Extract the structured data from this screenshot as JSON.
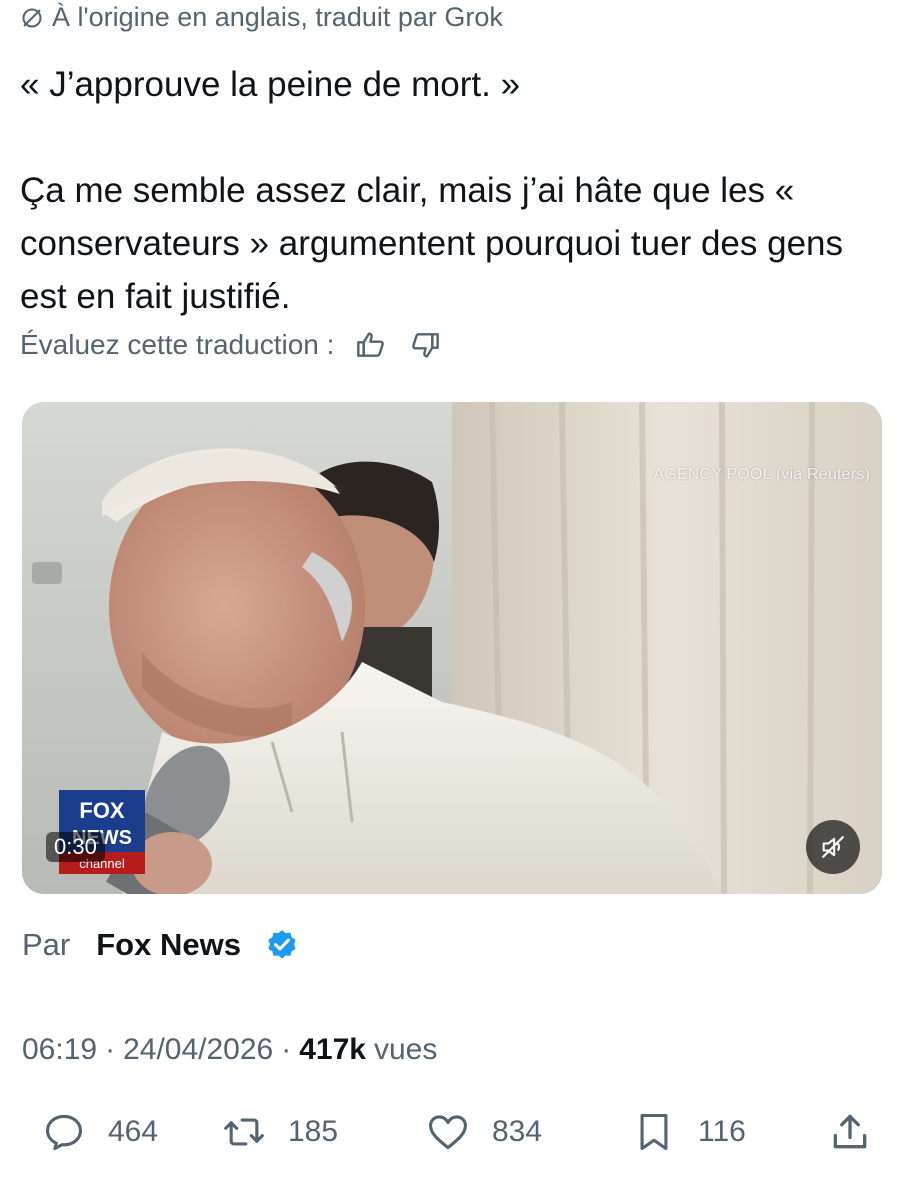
{
  "translation_note": {
    "icon": "translate-slash-icon",
    "text": "À l'origine en anglais, traduit par Grok"
  },
  "tweet": {
    "paragraph1": "« J’approuve la peine de mort. »",
    "paragraph2": "Ça me semble assez clair, mais j’ai hâte que les « conservateurs » argumentent pourquoi tuer des gens est en fait justifié."
  },
  "rate_translation": {
    "label": "Évaluez cette traduction :",
    "thumbs_up_icon": "thumbs-up-icon",
    "thumbs_down_icon": "thumbs-down-icon"
  },
  "video": {
    "credit": "AGENCY POOL (via Reuters)",
    "duration": "0:30",
    "logo_text": "FOX NEWS channel",
    "mute_icon": "speaker-muted-icon"
  },
  "byline": {
    "prefix": "Par",
    "source": "Fox News",
    "verified_icon": "verified-badge-icon"
  },
  "meta": {
    "time": "06:19",
    "date": "24/04/2026",
    "views_count": "417k",
    "views_label": "vues"
  },
  "actions": {
    "replies": "464",
    "reposts": "185",
    "likes": "834",
    "bookmarks": "116"
  },
  "colors": {
    "text": "#0f1419",
    "secondary": "#536471",
    "verified": "#1d9bf0"
  }
}
